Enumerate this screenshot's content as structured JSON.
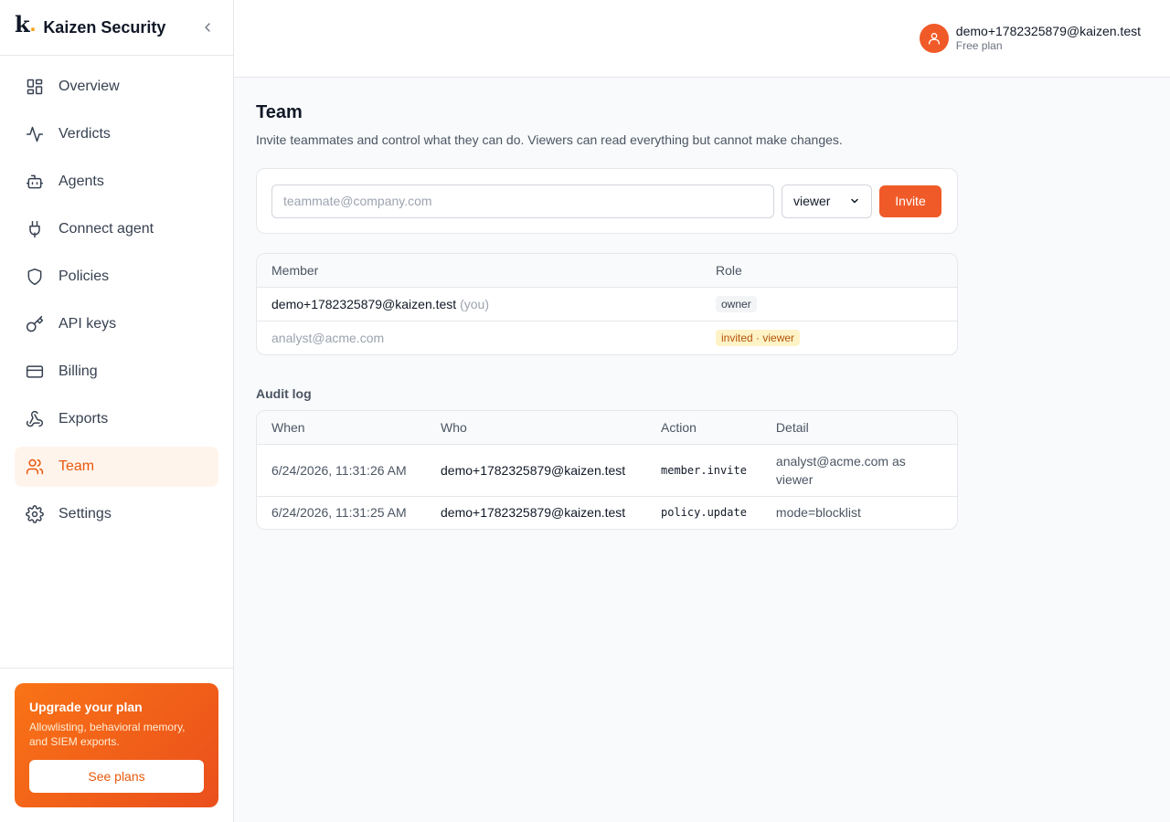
{
  "brand": {
    "logo_letter": "k",
    "logo_dot": ".",
    "name": "Kaizen Security"
  },
  "sidebar": {
    "items": [
      {
        "label": "Overview",
        "icon": "grid-icon"
      },
      {
        "label": "Verdicts",
        "icon": "activity-icon"
      },
      {
        "label": "Agents",
        "icon": "bot-icon"
      },
      {
        "label": "Connect agent",
        "icon": "plug-icon"
      },
      {
        "label": "Policies",
        "icon": "shield-icon"
      },
      {
        "label": "API keys",
        "icon": "key-icon"
      },
      {
        "label": "Billing",
        "icon": "credit-card-icon"
      },
      {
        "label": "Exports",
        "icon": "webhook-icon"
      },
      {
        "label": "Team",
        "icon": "users-icon",
        "active": true
      },
      {
        "label": "Settings",
        "icon": "gear-icon"
      }
    ],
    "upgrade": {
      "title": "Upgrade your plan",
      "body": "Allowlisting, behavioral memory, and SIEM exports.",
      "button": "See plans"
    }
  },
  "header": {
    "user_email": "demo+1782325879@kaizen.test",
    "plan": "Free plan"
  },
  "team": {
    "title": "Team",
    "subtitle": "Invite teammates and control what they can do. Viewers can read everything but cannot make changes.",
    "invite": {
      "email_placeholder": "teammate@company.com",
      "email_value": "",
      "role_selected": "viewer",
      "button": "Invite"
    },
    "members_headers": {
      "member": "Member",
      "role": "Role"
    },
    "members": [
      {
        "email": "demo+1782325879@kaizen.test",
        "you": "(you)",
        "role": "owner"
      },
      {
        "email": "analyst@acme.com",
        "role": "invited · viewer"
      }
    ]
  },
  "audit": {
    "title": "Audit log",
    "headers": {
      "when": "When",
      "who": "Who",
      "action": "Action",
      "detail": "Detail"
    },
    "rows": [
      {
        "when": "6/24/2026, 11:31:26 AM",
        "who": "demo+1782325879@kaizen.test",
        "action": "member.invite",
        "detail": "analyst@acme.com as viewer"
      },
      {
        "when": "6/24/2026, 11:31:25 AM",
        "who": "demo+1782325879@kaizen.test",
        "action": "policy.update",
        "detail": "mode=blocklist"
      }
    ]
  },
  "colors": {
    "accent": "#f05a28",
    "active_bg": "#fff4ec",
    "invited_bg": "#fef3c7"
  }
}
